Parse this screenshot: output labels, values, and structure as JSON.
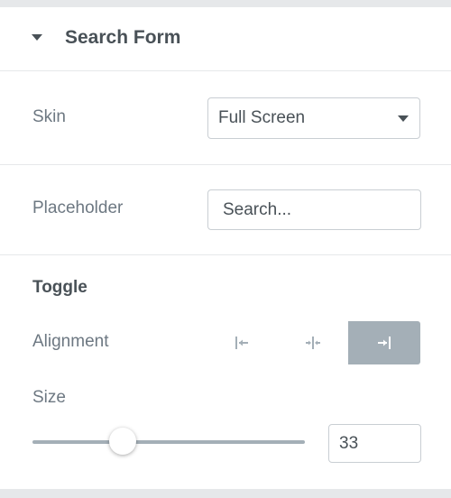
{
  "section": {
    "title": "Search Form",
    "expanded": true
  },
  "skin": {
    "label": "Skin",
    "value": "Full Screen",
    "icon": "caret-down-icon"
  },
  "placeholder_field": {
    "label": "Placeholder",
    "value": "Search..."
  },
  "toggle": {
    "heading": "Toggle",
    "alignment": {
      "label": "Alignment",
      "options": [
        {
          "name": "align-left",
          "icon": "align-left-icon",
          "active": false
        },
        {
          "name": "align-center",
          "icon": "align-center-icon",
          "active": false
        },
        {
          "name": "align-right",
          "icon": "align-right-icon",
          "active": true
        }
      ]
    },
    "size": {
      "label": "Size",
      "value": "33",
      "min": 0,
      "max": 100
    }
  },
  "colors": {
    "heading": "#495157",
    "label": "#6d7882",
    "active_button": "#a4afb7",
    "border": "#c9ced3",
    "divider": "#e6e8ea"
  }
}
